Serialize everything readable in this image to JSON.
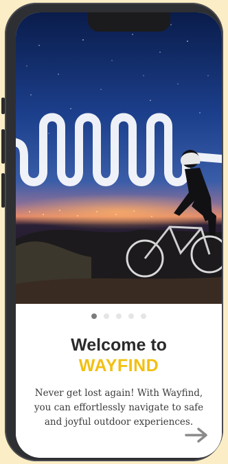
{
  "onboarding": {
    "title": "Welcome to",
    "brand": "WAYFIND",
    "description": "Never get lost again! With Wayfind, you can effortlessly navigate to safe and joyful outdoor experiences.",
    "pagination": {
      "total": 5,
      "current": 1
    },
    "next_icon": "arrow-right-icon"
  },
  "colors": {
    "background": "#fbedc6",
    "brand": "#f2c012",
    "title": "#2a2a2a",
    "dot_active": "#7c7c7c",
    "dot_inactive": "#e5e5e5"
  }
}
